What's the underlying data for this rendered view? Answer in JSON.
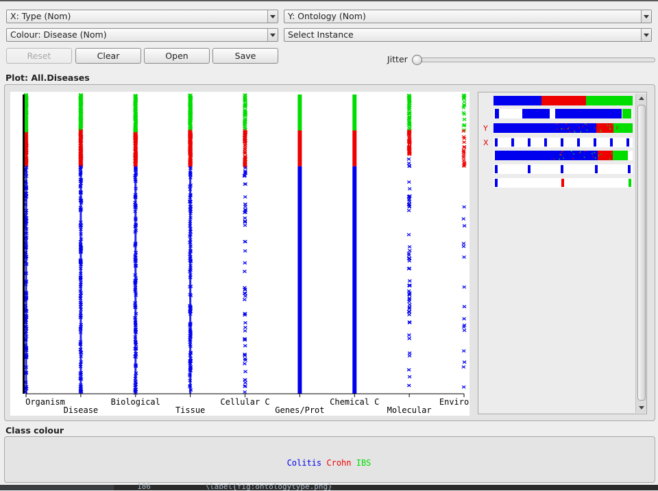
{
  "controls": {
    "x_axis": "X: Type (Nom)",
    "y_axis": "Y: Ontology (Nom)",
    "colour": "Colour: Disease (Nom)",
    "instance": "Select Instance"
  },
  "buttons": {
    "reset": "Reset",
    "clear": "Clear",
    "open": "Open",
    "save": "Save"
  },
  "jitter": {
    "label": "Jitter",
    "value": 0
  },
  "plot": {
    "title": "Plot: All.Diseases",
    "class_colour_title": "Class colour"
  },
  "chart_data": {
    "type": "scatter",
    "x_attribute": "Type",
    "x_categories": [
      "Organism",
      "Disease",
      "Biological",
      "Tissue",
      "Cellular C",
      "Genes/Prot",
      "Chemical C",
      "Molecular",
      "Environmen"
    ],
    "marker": "x",
    "classes": [
      "Colitis",
      "Crohn",
      "IBS"
    ],
    "colors": {
      "Colitis": "#0000ee",
      "Crohn": "#ee0000",
      "IBS": "#00dd00",
      "axis": "#000000"
    }
  },
  "matrix": {
    "y_label": "Y",
    "x_label": "X"
  },
  "legend": [
    {
      "name": "Colitis",
      "color": "#0000ee"
    },
    {
      "name": "Crohn",
      "color": "#ee0000"
    },
    {
      "name": "IBS",
      "color": "#00dd00"
    }
  ],
  "background_code": {
    "line_no": "186",
    "text": "\\label{fig:ontologytype.png}"
  }
}
